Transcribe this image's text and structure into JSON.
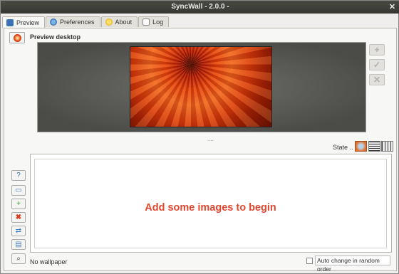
{
  "window": {
    "title": "SyncWall - 2.0.0 -"
  },
  "tabs": [
    {
      "label": "Preview",
      "icon": "monitor-icon",
      "active": true
    },
    {
      "label": "Preferences",
      "icon": "globe-icon",
      "active": false
    },
    {
      "label": "About",
      "icon": "lightbulb-icon",
      "active": false
    },
    {
      "label": "Log",
      "icon": "document-icon",
      "active": false
    }
  ],
  "preview": {
    "label": "Preview desktop",
    "side_buttons": [
      "add-icon",
      "check-icon",
      "remove-icon"
    ]
  },
  "splitter": "....",
  "state": {
    "label": "State ..",
    "icons": [
      "picture-state-icon",
      "grid-state-icon",
      "columns-state-icon"
    ]
  },
  "images": {
    "empty_message": "Add some images to begin"
  },
  "toolbar": {
    "help_icon": "help-icon",
    "folder_icon": "folder-icon",
    "add_file_icon": "add-file-icon",
    "delete_icon": "delete-icon",
    "sync_icon": "sync-icon",
    "slideshow_icon": "slideshow-icon",
    "search_icon": "search-icon"
  },
  "status": {
    "wallpaper": "No wallpaper",
    "auto_change_label": "Auto change in random order",
    "auto_change_checked": false
  },
  "colors": {
    "accent_message": "#e0472e",
    "titlebar": "#3d3d39"
  }
}
